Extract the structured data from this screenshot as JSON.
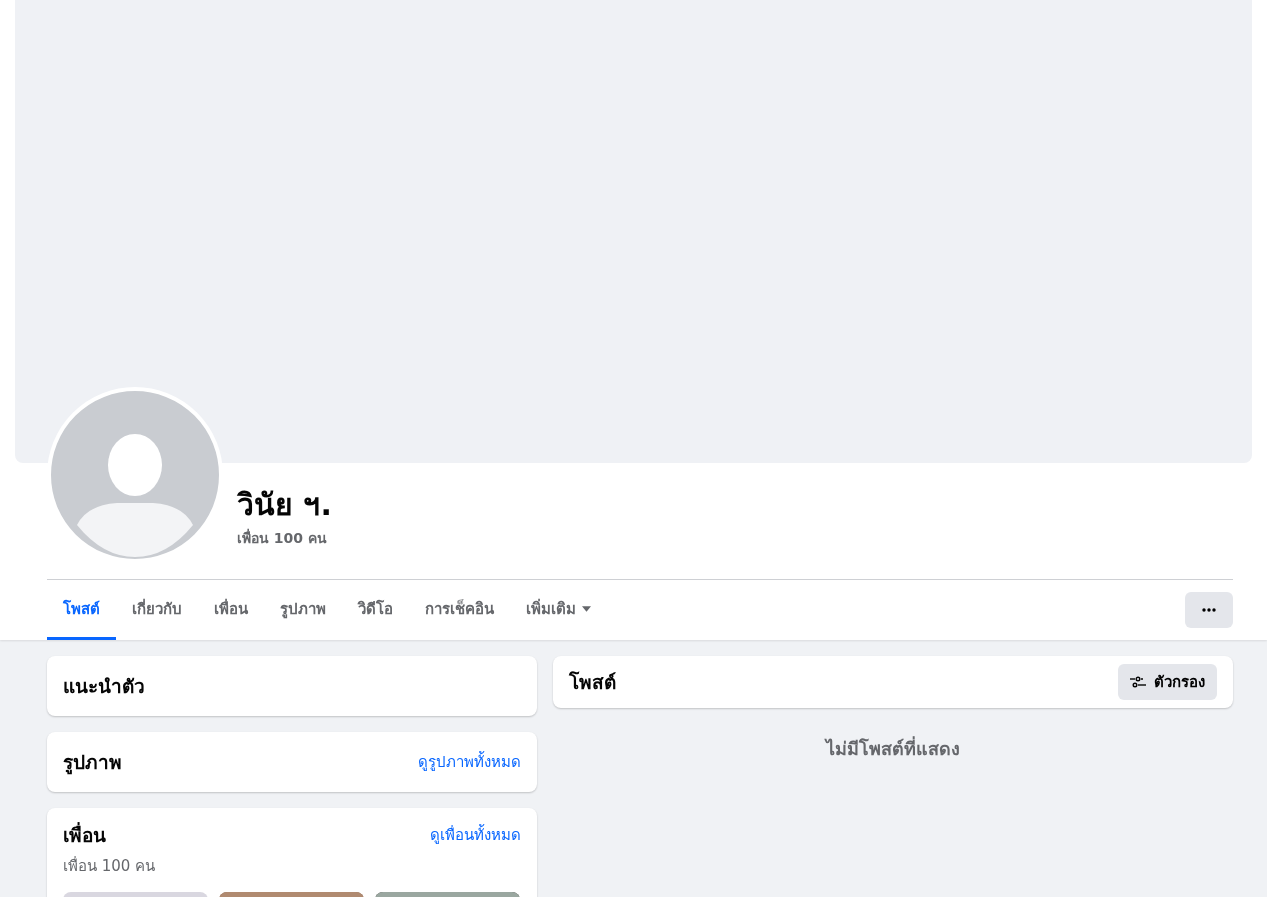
{
  "profile": {
    "name": "วินัย ฯ.",
    "friends_count": "เพื่อน 100 คน"
  },
  "tabs": [
    {
      "label": "โพสต์",
      "selected": true,
      "has_menu": false
    },
    {
      "label": "เกี่ยวกับ",
      "selected": false,
      "has_menu": false
    },
    {
      "label": "เพื่อน",
      "selected": false,
      "has_menu": false
    },
    {
      "label": "รูปภาพ",
      "selected": false,
      "has_menu": false
    },
    {
      "label": "วิดีโอ",
      "selected": false,
      "has_menu": false
    },
    {
      "label": "การเช็คอิน",
      "selected": false,
      "has_menu": false
    },
    {
      "label": "เพิ่มเติม",
      "selected": false,
      "has_menu": true
    }
  ],
  "intro": {
    "title": "แนะนำตัว"
  },
  "photos": {
    "title": "รูปภาพ",
    "link": "ดูรูปภาพทั้งหมด"
  },
  "friends": {
    "title": "เพื่อน",
    "link": "ดูเพื่อนทั้งหมด",
    "count": "เพื่อน 100 คน",
    "thumbnails": [
      {
        "kind": "blank"
      },
      {
        "kind": "picture"
      },
      {
        "kind": "picture"
      }
    ]
  },
  "posts": {
    "title": "โพสต์",
    "filter_button": "ตัวกรอง",
    "empty_message": "ไม่มีโพสต์ที่แสดง"
  }
}
